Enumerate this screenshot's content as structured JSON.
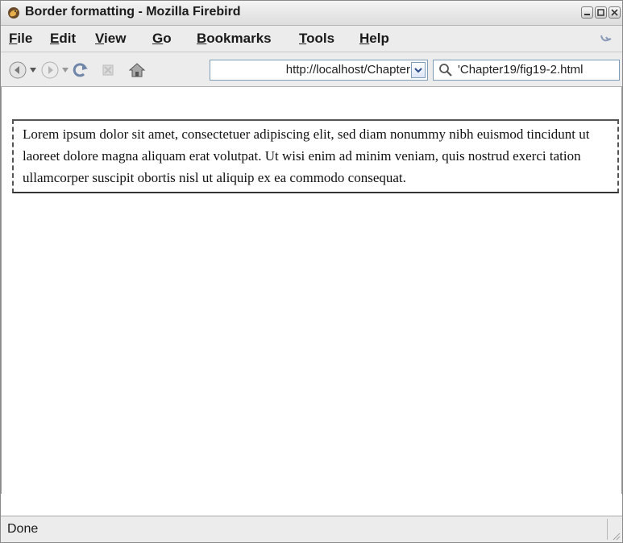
{
  "window": {
    "title": "Border formatting - Mozilla Firebird"
  },
  "menubar": {
    "items": [
      {
        "label": "File",
        "accel": "F"
      },
      {
        "label": "Edit",
        "accel": "E"
      },
      {
        "label": "View",
        "accel": "V"
      },
      {
        "label": "Go",
        "accel": "G"
      },
      {
        "label": "Bookmarks",
        "accel": "B"
      },
      {
        "label": "Tools",
        "accel": "T"
      },
      {
        "label": "Help",
        "accel": "H"
      }
    ]
  },
  "navbar": {
    "url_value": "http://localhost/Chapter",
    "search_value": "'Chapter19/fig19-2.html",
    "icons": [
      "back-icon",
      "forward-icon",
      "reload-icon",
      "stop-icon",
      "home-icon"
    ]
  },
  "content": {
    "paragraph": "Lorem ipsum dolor sit amet, consectetuer adipiscing elit, sed diam nonummy nibh euismod tincidunt ut laoreet dolore magna aliquam erat volutpat. Ut wisi enim ad minim veniam, quis nostrud exerci tation ullamcorper suscipit obortis nisl ut aliquip ex ea commodo consequat."
  },
  "statusbar": {
    "text": "Done"
  },
  "colors": {
    "chrome": "#ececec",
    "border": "#555555",
    "field_border": "#7f9db9"
  }
}
